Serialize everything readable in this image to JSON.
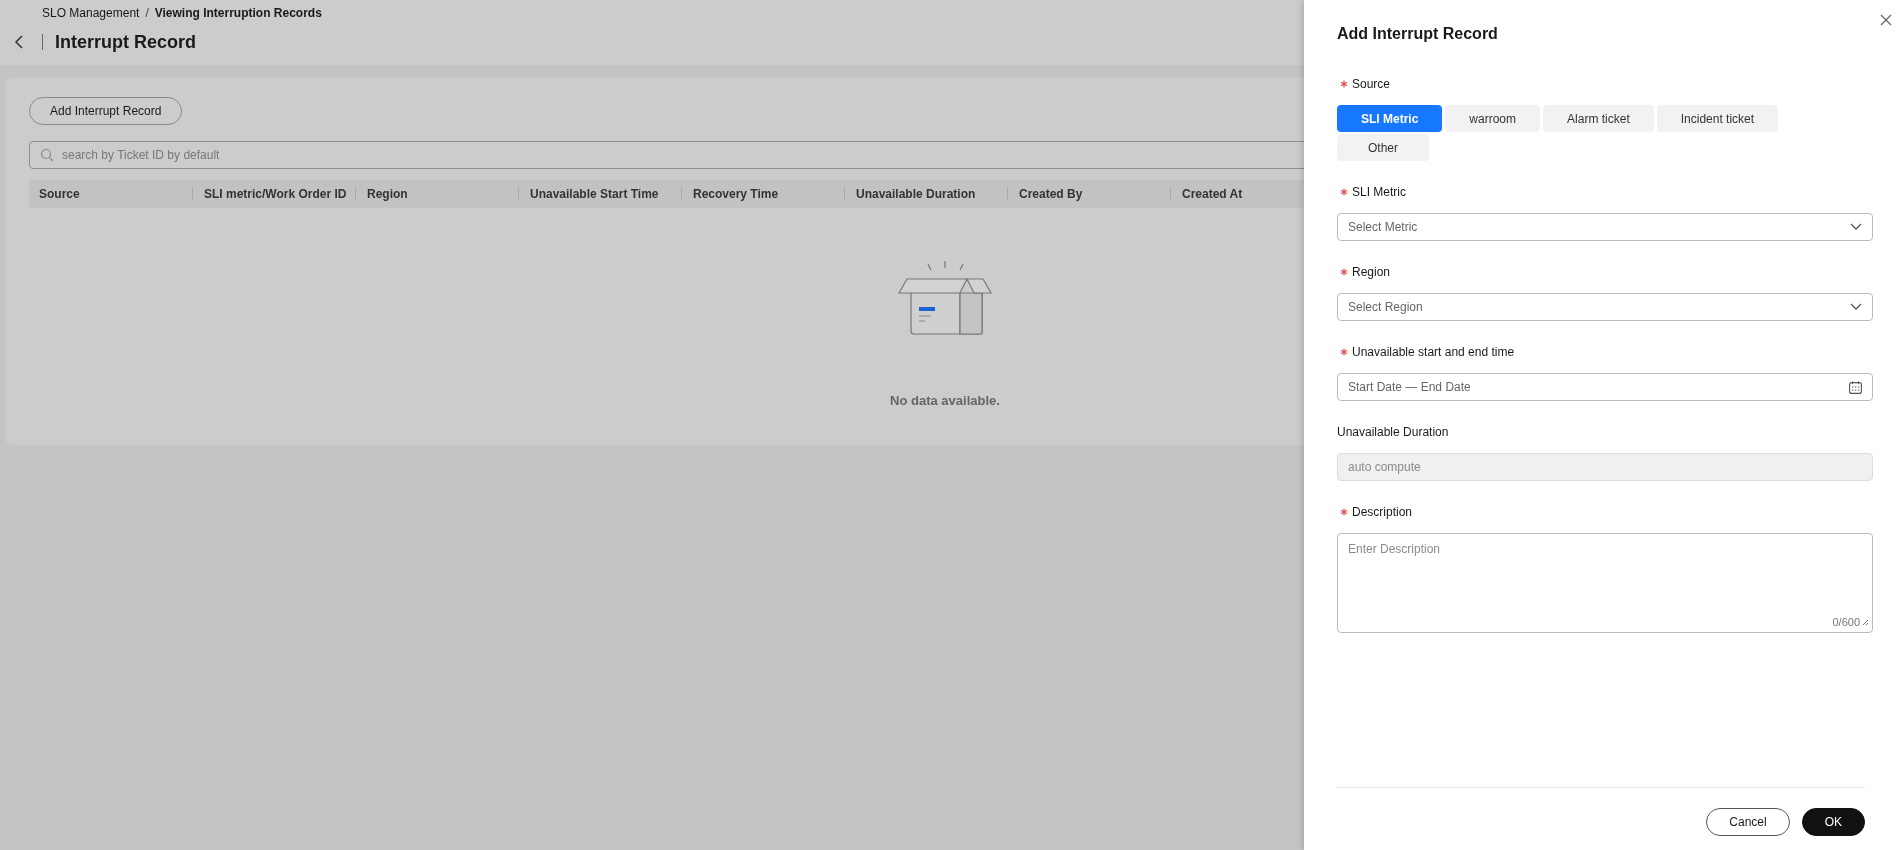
{
  "breadcrumb": {
    "separator": "/",
    "items": [
      {
        "label": "SLO Management",
        "current": false
      },
      {
        "label": "Viewing Interruption Records",
        "current": true
      }
    ]
  },
  "page": {
    "title": "Interrupt Record"
  },
  "toolbar": {
    "add_button": "Add Interrupt Record"
  },
  "search": {
    "placeholder": "search by Ticket ID by default"
  },
  "table": {
    "columns": [
      "Source",
      "SLI metric/Work Order ID",
      "Region",
      "Unavailable Start Time",
      "Recovery Time",
      "Unavailable Duration",
      "Created By",
      "Created At"
    ],
    "empty_text": "No data available."
  },
  "drawer": {
    "title": "Add Interrupt Record",
    "fields": [
      {
        "kind": "segmented",
        "label": "Source",
        "required": true,
        "options": [
          {
            "label": "SLI Metric",
            "selected": true
          },
          {
            "label": "warroom",
            "selected": false
          },
          {
            "label": "Alarm ticket",
            "selected": false
          },
          {
            "label": "Incident ticket",
            "selected": false
          },
          {
            "label": "Other",
            "selected": false
          }
        ]
      },
      {
        "kind": "select",
        "label": "SLI Metric",
        "required": true,
        "placeholder": "Select Metric"
      },
      {
        "kind": "select",
        "label": "Region",
        "required": true,
        "placeholder": "Select Region"
      },
      {
        "kind": "date-range",
        "label": "Unavailable start and end time",
        "required": true,
        "placeholder": "Start Date — End Date"
      },
      {
        "kind": "input",
        "label": "Unavailable Duration",
        "required": false,
        "disabled": true,
        "placeholder": "auto compute"
      },
      {
        "kind": "textarea",
        "label": "Description",
        "required": true,
        "placeholder": "Enter Description",
        "counter": "0/600"
      }
    ],
    "buttons": [
      {
        "label": "Cancel",
        "kind": "secondary"
      },
      {
        "label": "OK",
        "kind": "primary"
      }
    ]
  }
}
